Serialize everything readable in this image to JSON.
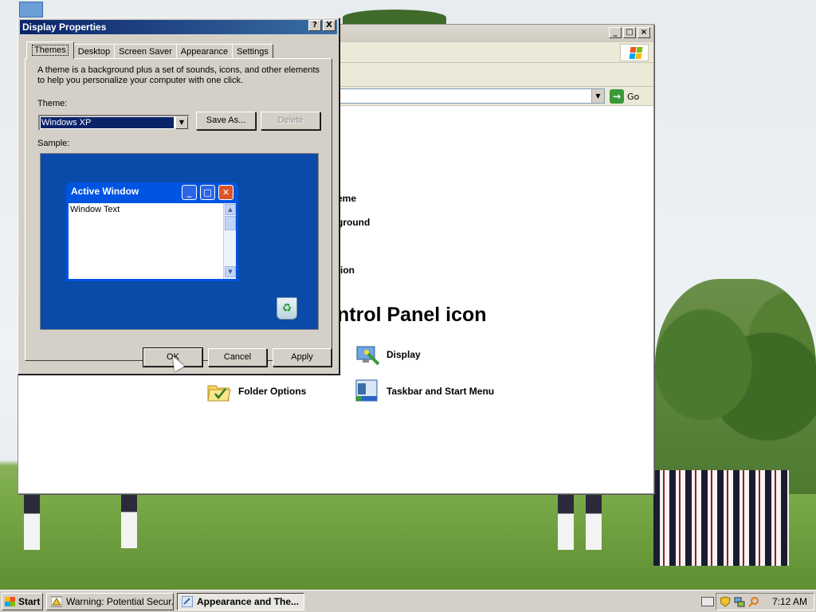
{
  "control_panel": {
    "go_label": "Go",
    "task_links": [
      "eme",
      "ground",
      "tion"
    ],
    "pick_heading": "ntrol Panel icon",
    "items": [
      {
        "label": "Display",
        "icon": "display-icon"
      },
      {
        "label": "Folder Options",
        "icon": "folder-options-icon"
      },
      {
        "label": "Taskbar and Start Menu",
        "icon": "taskbar-icon"
      }
    ]
  },
  "dialog": {
    "title": "Display Properties",
    "help_button": "?",
    "close_button": "X",
    "tabs": [
      "Themes",
      "Desktop",
      "Screen Saver",
      "Appearance",
      "Settings"
    ],
    "active_tab": "Themes",
    "description": "A theme is a background plus a set of sounds, icons, and other elements to help you personalize your computer with one click.",
    "theme_label": "Theme:",
    "theme_value": "Windows XP",
    "save_as": "Save As...",
    "delete": "Delete",
    "sample_label": "Sample:",
    "sample_window_title": "Active Window",
    "sample_window_text": "Window Text",
    "ok": "OK",
    "cancel": "Cancel",
    "apply": "Apply"
  },
  "taskbar": {
    "start": "Start",
    "items": [
      {
        "label": "Warning: Potential Secur...",
        "active": false
      },
      {
        "label": "Appearance and The...",
        "active": true
      }
    ],
    "clock": "7:12 AM"
  },
  "colors": {
    "dialog_title": "#0a246a",
    "sample_bg": "#0a4aa8",
    "xp_title": "#0054e3",
    "selection": "#0a246a"
  }
}
